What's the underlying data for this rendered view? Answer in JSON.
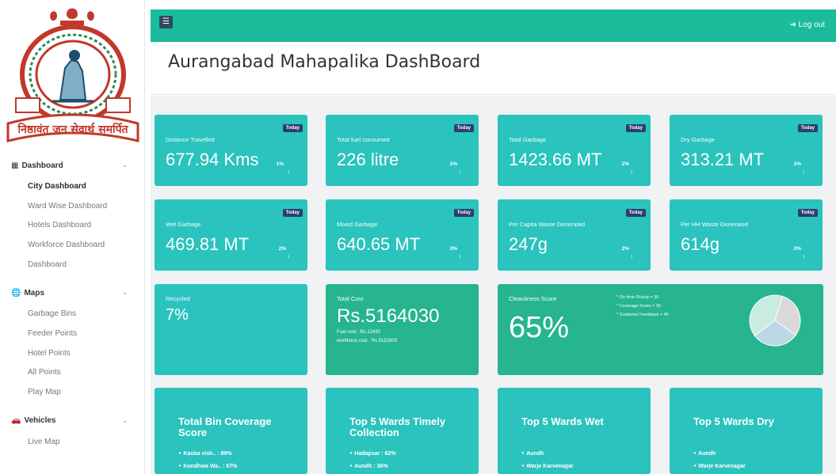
{
  "app": {
    "title": "Aurangabad Mahapalika DashBoard",
    "logout_label": "Log out",
    "menu_icon": "hamburger-icon"
  },
  "logo": {
    "text": "निष्ठावंत जन सेवार्थ समर्पित",
    "alt": "Aurangabad Municipal Corporation emblem"
  },
  "sidebar": {
    "sections": [
      {
        "label": "Dashboard",
        "icon": "grid-icon",
        "items": [
          "City Dashboard",
          "Ward Wise Dashboard",
          "Hotels Dashboard",
          "Workforce Dashboard",
          "Dashboard"
        ]
      },
      {
        "label": "Maps",
        "icon": "globe-icon",
        "items": [
          "Garbage Bins",
          "Feeder Points",
          "Hotel Points",
          "All Points",
          "Play Map"
        ]
      },
      {
        "label": "Vehicles",
        "icon": "car-icon",
        "items": [
          "Live Map"
        ]
      }
    ]
  },
  "row1": [
    {
      "label": "Distance Travelled",
      "value": "677.94 Kms",
      "badge": "Today",
      "change": "1%"
    },
    {
      "label": "Total fuel consumed",
      "value": "226 litre",
      "badge": "Today",
      "change": "2%"
    },
    {
      "label": "Total Garbage",
      "value": "1423.66 MT",
      "badge": "Today",
      "change": "2%"
    },
    {
      "label": "Dry Garbage",
      "value": "313.21 MT",
      "badge": "Today",
      "change": "2%"
    }
  ],
  "row2": [
    {
      "label": "Wet Garbage",
      "value": "469.81 MT",
      "badge": "Today",
      "change": "2%"
    },
    {
      "label": "Mixed Garbage",
      "value": "640.65 MT",
      "badge": "Today",
      "change": "2%"
    },
    {
      "label": "Per Capita Waste Generated",
      "value": "247g",
      "badge": "Today",
      "change": "2%"
    },
    {
      "label": "Per HH Waste Generated",
      "value": "614g",
      "badge": "Today",
      "change": "2%"
    }
  ],
  "recycled": {
    "label": "Recycled",
    "value": "7%"
  },
  "total_cost": {
    "label": "Total Cost",
    "value": "Rs.5164030",
    "fuel_cost": "Fuel cost : Rs.12430",
    "workforce_cost": "workforce cost : Rs.5151600"
  },
  "cleanliness": {
    "label": "Cleanliness Score",
    "value": "65%",
    "legend": [
      "* On time Pickup = 30",
      "* Coverage Score = 30",
      "* Customer Feedback = 40"
    ],
    "pie": [
      {
        "name": "On time Pickup",
        "value": 30,
        "color": "#d9d9d9"
      },
      {
        "name": "Coverage Score",
        "value": 30,
        "color": "#bcd7e6"
      },
      {
        "name": "Customer Feedback",
        "value": 40,
        "color": "#c8ece2"
      }
    ]
  },
  "bottom": [
    {
      "title": "Total Bin Coverage Score",
      "items": [
        "Kasba vish.. : 89%",
        "Kondhwa Wa.. : 67%"
      ]
    },
    {
      "title": "Top 5 Wards Timely Collection",
      "items": [
        "Hadapsar : 62%",
        "Aundh : 36%"
      ]
    },
    {
      "title": "Top 5 Wards Wet",
      "items": [
        "Aundh",
        "Warje Karvenagar"
      ]
    },
    {
      "title": "Top 5 Wards Dry",
      "items": [
        "Aundh",
        "Warje Karvenagar"
      ]
    }
  ],
  "colors": {
    "topbar": "#1abc9c",
    "card": "#2ac3be",
    "card_green": "#26b58e",
    "badge": "#2c3e6b"
  }
}
